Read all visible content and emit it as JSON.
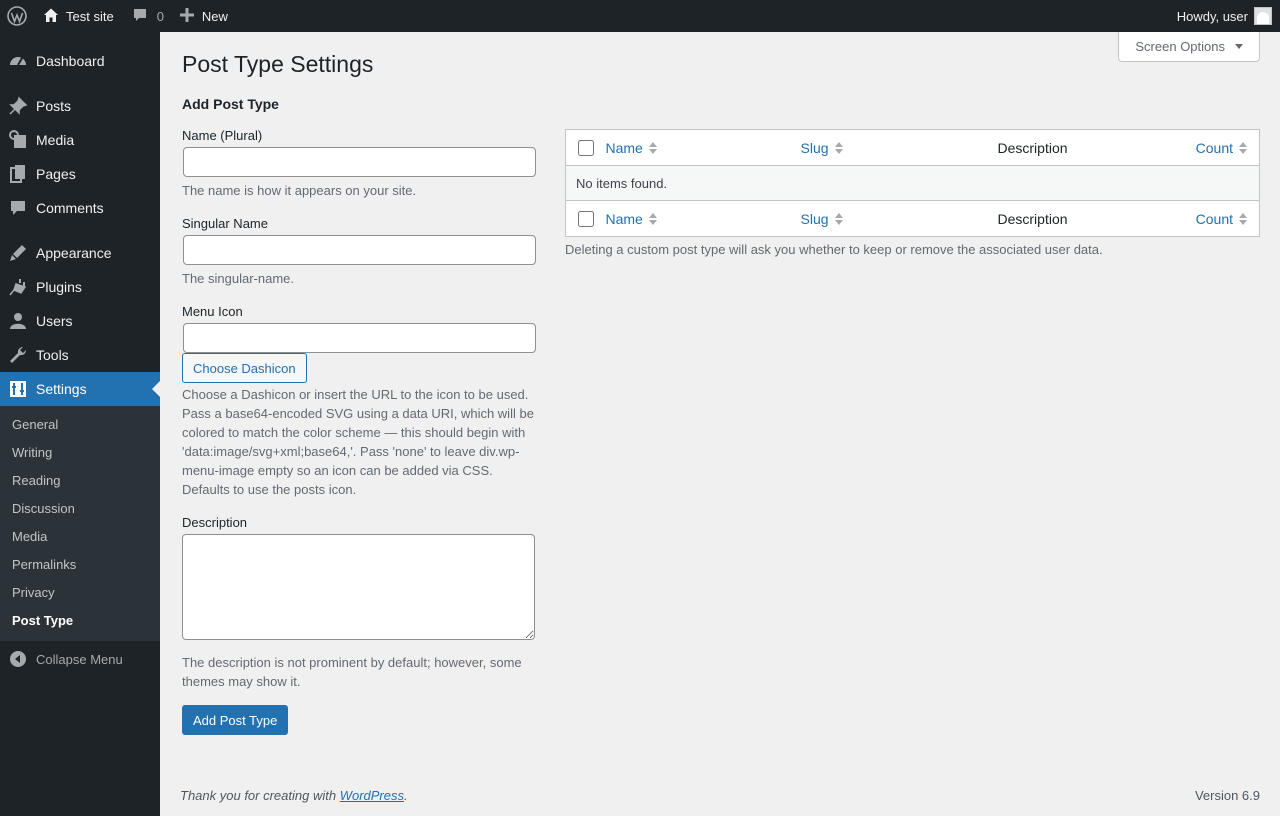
{
  "adminbar": {
    "site_name": "Test site",
    "comments_count": "0",
    "new_label": "New",
    "howdy": "Howdy, user"
  },
  "sidebar": {
    "items": [
      {
        "label": "Dashboard",
        "icon": "dashboard-icon"
      },
      {
        "label": "Posts",
        "icon": "pin-icon"
      },
      {
        "label": "Media",
        "icon": "media-icon"
      },
      {
        "label": "Pages",
        "icon": "pages-icon"
      },
      {
        "label": "Comments",
        "icon": "comment-icon"
      },
      {
        "label": "Appearance",
        "icon": "brush-icon"
      },
      {
        "label": "Plugins",
        "icon": "plugin-icon"
      },
      {
        "label": "Users",
        "icon": "user-icon"
      },
      {
        "label": "Tools",
        "icon": "wrench-icon"
      },
      {
        "label": "Settings",
        "icon": "settings-icon"
      }
    ],
    "submenu": [
      "General",
      "Writing",
      "Reading",
      "Discussion",
      "Media",
      "Permalinks",
      "Privacy",
      "Post Type"
    ],
    "collapse_label": "Collapse Menu"
  },
  "screen_options": "Screen Options",
  "page_title": "Post Type Settings",
  "form": {
    "heading": "Add Post Type",
    "name_label": "Name (Plural)",
    "name_value": "",
    "name_desc": "The name is how it appears on your site.",
    "singular_label": "Singular Name",
    "singular_value": "",
    "singular_desc": "The singular-name.",
    "icon_label": "Menu Icon",
    "icon_value": "",
    "choose_dashicon": "Choose Dashicon",
    "icon_desc": "Choose a Dashicon or insert the URL to the icon to be used. Pass a base64-encoded SVG using a data URI, which will be colored to match the color scheme — this should begin with 'data:image/svg+xml;base64,'. Pass 'none' to leave div.wp-menu-image empty so an icon can be added via CSS. Defaults to use the posts icon.",
    "description_label": "Description",
    "description_value": "",
    "description_desc": "The description is not prominent by default; however, some themes may show it.",
    "submit_label": "Add Post Type"
  },
  "table": {
    "columns": {
      "name": "Name",
      "slug": "Slug",
      "description": "Description",
      "count": "Count"
    },
    "empty": "No items found.",
    "note": "Deleting a custom post type will ask you whether to keep or remove the associated user data."
  },
  "footer": {
    "thanks_prefix": "Thank you for creating with ",
    "thanks_link": "WordPress",
    "thanks_suffix": ".",
    "version": "Version 6.9"
  },
  "colors": {
    "accent": "#2271b1",
    "adminbar": "#1d2327",
    "submenu_bg": "#2c3338"
  }
}
